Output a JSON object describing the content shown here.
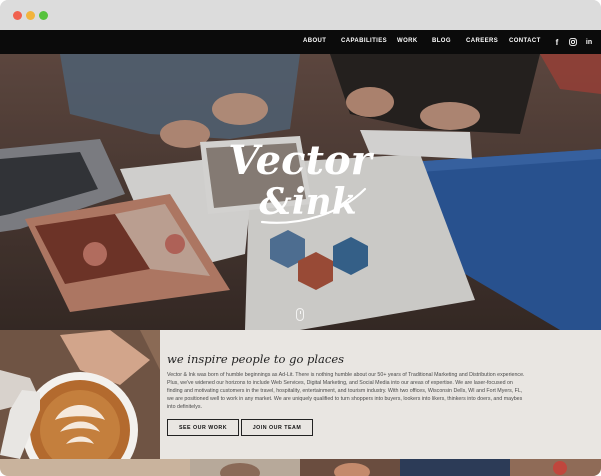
{
  "browser": {
    "traffic_lights": [
      "close",
      "minimize",
      "zoom"
    ]
  },
  "nav": {
    "items": [
      "ABOUT",
      "CAPABILITIES",
      "WORK",
      "BLOG",
      "CAREERS",
      "CONTACT"
    ],
    "social": [
      {
        "icon": "facebook-icon",
        "glyph": "f"
      },
      {
        "icon": "instagram-icon",
        "glyph": ""
      },
      {
        "icon": "linkedin-icon",
        "glyph": "in"
      }
    ]
  },
  "hero": {
    "logo_line1": "Vector",
    "logo_line2": "&ink",
    "scroll_icon": "mouse-scroll-icon"
  },
  "intro": {
    "tagline": "we inspire people to go places",
    "paragraph": "Vector & Ink was born of humble beginnings as Ad-Lit. There is nothing humble about our 50+ years of Traditional Marketing and Distribution experience. Plus, we've widened our horizons to include Web Services, Digital Marketing, and Social Media into our areas of expertise. We are laser-focused on finding and motivating customers in the travel, hospitality, entertainment, and tourism industry. With two offices, Wisconsin Dells, WI and Fort Myers, FL, we are positioned well to work in any market. We are uniquely qualified to turn shoppers into buyers, lookers into likers, thinkers into doers, and maybes into definitelys.",
    "buttons": {
      "see_work": "SEE OUR WORK",
      "join_team": "JOIN OUR TEAM"
    }
  },
  "colors": {
    "nav_bg": "#0b0b0b",
    "intro_bg": "#e9e6e2",
    "accent_blue": "#2f5fa6"
  }
}
